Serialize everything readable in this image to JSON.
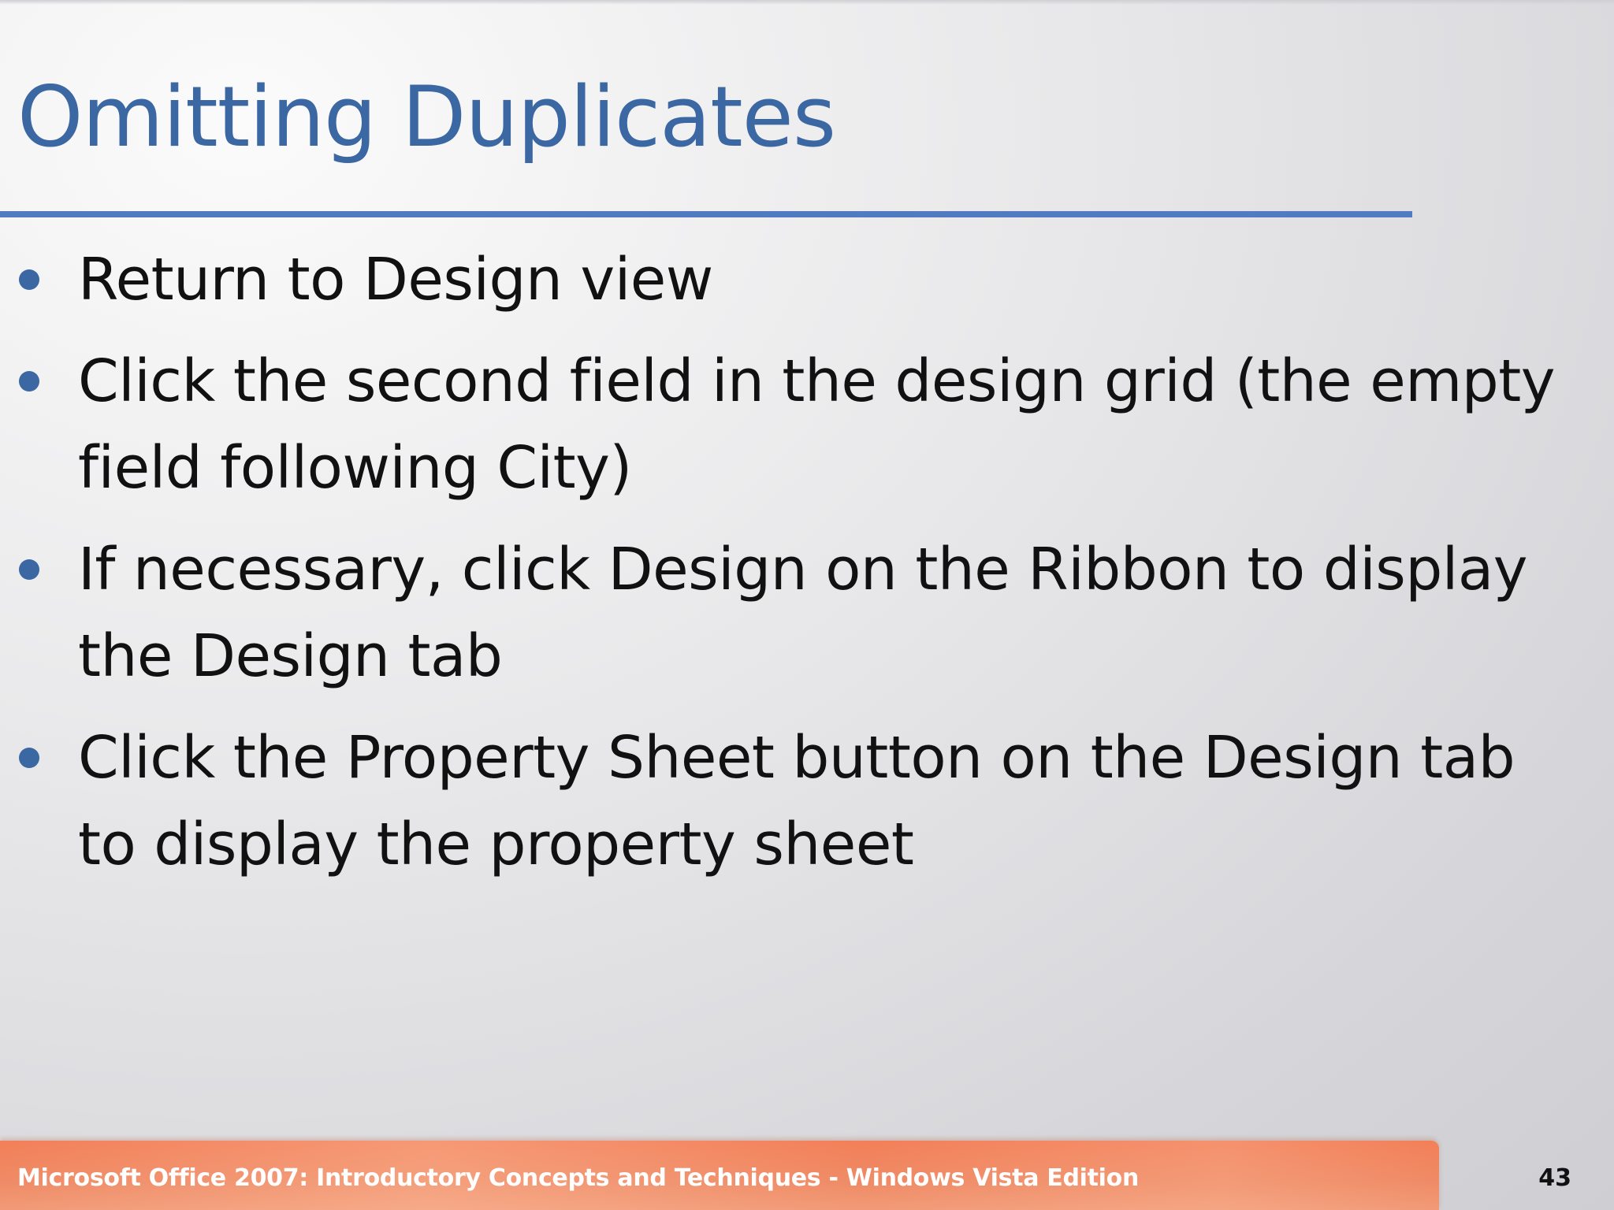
{
  "slide": {
    "title": "Omitting Duplicates",
    "bullets": [
      "Return to Design view",
      "Click the second field in the design grid (the empty field following City)",
      "If necessary, click Design on the Ribbon to display the Design tab",
      "Click the Property Sheet button on the Design tab to display the property sheet"
    ],
    "footer": "Microsoft Office 2007: Introductory Concepts and Techniques - Windows Vista Edition",
    "page_number": "43"
  },
  "colors": {
    "title": "#3b67a3",
    "rule": "#4f7cc0",
    "bullet_dot": "#3b67a3",
    "footer_bar": "#f27f58"
  }
}
